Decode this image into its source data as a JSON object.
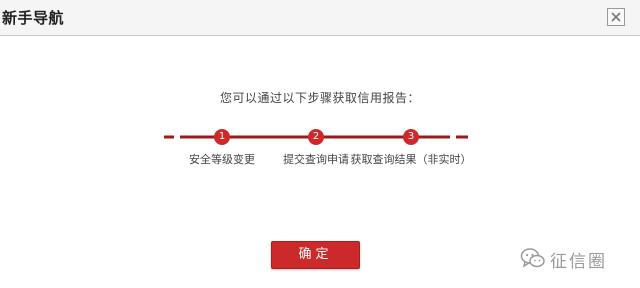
{
  "dialog": {
    "title": "新手导航",
    "subtitle": "您可以通过以下步骤获取信用报告：",
    "confirm_label": "确定"
  },
  "steps": [
    {
      "number": "1",
      "label": "安全等级变更"
    },
    {
      "number": "2",
      "label": "提交查询申请"
    },
    {
      "number": "3",
      "label": "获取查询结果（非实时）"
    }
  ],
  "watermark": {
    "text": "征信圈"
  },
  "colors": {
    "accent": "#cc2a2a",
    "step_line": "#9a1b1b"
  },
  "icons": {
    "close": "close-icon",
    "watermark": "wechat-icon"
  }
}
